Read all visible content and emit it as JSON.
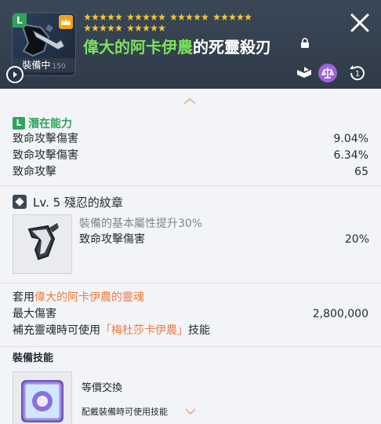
{
  "header": {
    "item_name_highlight": "偉大的阿卡伊農",
    "item_name_rest": "的死靈殺刃",
    "equipped_label": "裝備中",
    "equipped_level": "150",
    "grade_badge": "L",
    "star_rows": [
      [
        5,
        5,
        5,
        5
      ],
      [
        5,
        5
      ]
    ]
  },
  "potential": {
    "badge": "L",
    "title": "潛在能力",
    "lines": [
      {
        "name": "致命攻擊傷害",
        "value": "9.04%"
      },
      {
        "name": "致命攻擊傷害",
        "value": "6.34%"
      },
      {
        "name": "致命攻擊",
        "value": "65"
      }
    ]
  },
  "emblem": {
    "title": "Lv. 5 殘忍的紋章",
    "desc": "裝備的基本屬性提升30%",
    "stat_name": "致命攻擊傷害",
    "stat_value": "20%"
  },
  "soul": {
    "prefix": "套用",
    "soul_name": "偉大的阿卡伊農的靈魂",
    "stat_name": "最大傷害",
    "stat_value": "2,800,000",
    "skill_prefix": "補充靈魂時可使用",
    "skill_name": "「梅杜莎卡伊農」",
    "skill_suffix": "技能"
  },
  "equip_skill": {
    "title": "裝備技能",
    "name": "等價交換",
    "desc": "配戴裝備時可使用技能"
  },
  "colors": {
    "header_bg": "#333f4d",
    "accent_green": "#7be35c",
    "potential_green": "#2fa35a",
    "soul_orange": "#ee7b3b",
    "star_gold": "#f2c531"
  }
}
